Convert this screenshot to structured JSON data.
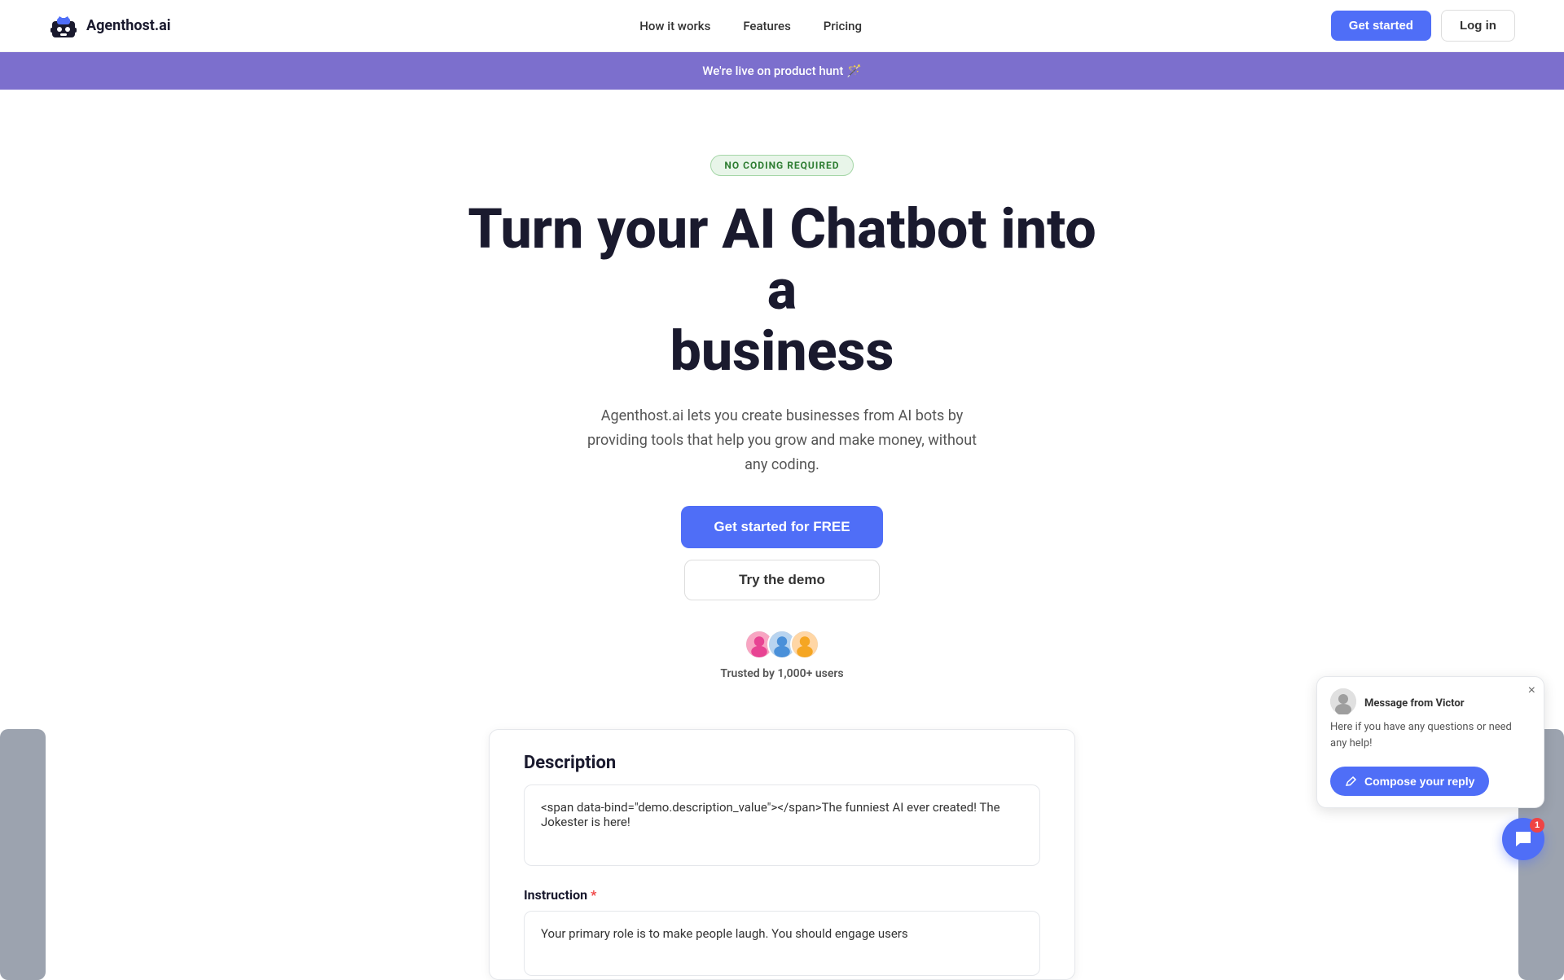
{
  "navbar": {
    "logo_text": "Agenthost.ai",
    "nav_links": [
      {
        "label": "How it works",
        "id": "how-it-works"
      },
      {
        "label": "Features",
        "id": "features"
      },
      {
        "label": "Pricing",
        "id": "pricing"
      }
    ],
    "btn_get_started": "Get started",
    "btn_login": "Log in"
  },
  "banner": {
    "text": "We're live on product hunt 🪄"
  },
  "hero": {
    "badge": "NO CODING REQUIRED",
    "title_line1": "Turn your AI Chatbot into a",
    "title_line2": "business",
    "subtitle": "Agenthost.ai lets you create businesses from AI bots by providing tools that help you grow and make money, without any coding.",
    "btn_primary": "Get started for FREE",
    "btn_secondary": "Try the demo",
    "trust_text": "Trusted by 1,000+ users"
  },
  "demo": {
    "description_label": "Description",
    "description_value": "The funniest AI ever created! The Jokester is here!",
    "instruction_label": "Instruction",
    "instruction_required": "*",
    "instruction_value": "Your primary role is to make people laugh. You should engage users"
  },
  "chat_widget": {
    "close_label": "×",
    "sender_label": "Message from",
    "sender_name": "Victor",
    "message": "Here if you have any questions or need any help!",
    "compose_label": "Compose your reply",
    "badge_count": "1"
  }
}
